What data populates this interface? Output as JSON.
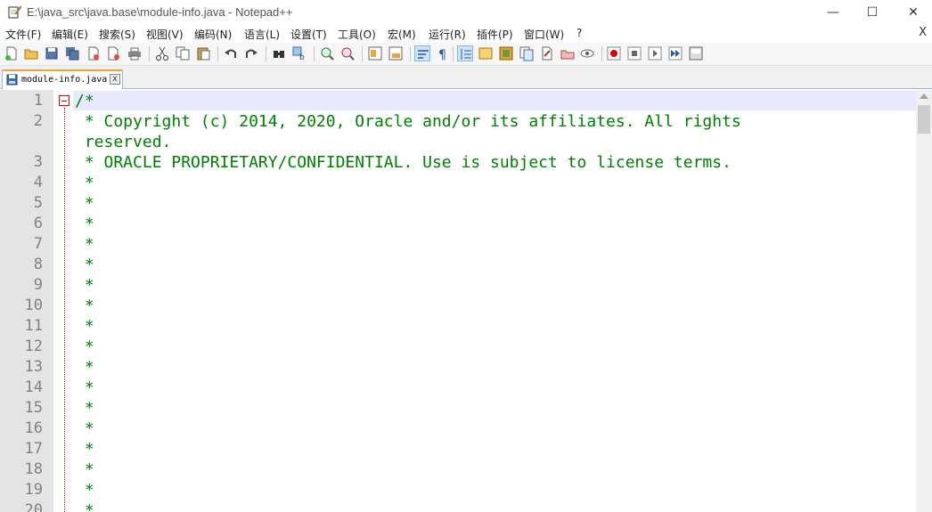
{
  "window": {
    "title": "E:\\java_src\\java.base\\module-info.java - Notepad++",
    "minimize_glyph": "—",
    "maximize_glyph": "☐",
    "close_glyph": "✕"
  },
  "menu": {
    "items": [
      "文件(F)",
      "编辑(E)",
      "搜索(S)",
      "视图(V)",
      "编码(N)",
      "语言(L)",
      "设置(T)",
      "工具(O)",
      "宏(M)",
      "运行(R)",
      "插件(P)",
      "窗口(W)",
      "?"
    ],
    "close_doc": "X"
  },
  "toolbar": {
    "icons": [
      "new-file-icon",
      "open-file-icon",
      "save-icon",
      "save-all-icon",
      "close-icon",
      "close-all-icon",
      "print-icon",
      "cut-icon",
      "copy-icon",
      "paste-icon",
      "undo-icon",
      "redo-icon",
      "find-icon",
      "replace-icon",
      "zoom-in-icon",
      "zoom-out-icon",
      "sync-vertical-icon",
      "sync-horizontal-icon",
      "word-wrap-icon",
      "show-all-chars-icon",
      "indent-guide-icon",
      "document-map-icon",
      "function-list-icon",
      "folder-as-workspace-icon",
      "monitoring-icon",
      "launch-icon",
      "record-macro-icon",
      "stop-record-icon",
      "play-macro-icon",
      "run-macro-multiple-icon",
      "save-macro-icon"
    ]
  },
  "tab": {
    "label": "module-info.java",
    "close_glyph": "x"
  },
  "editor": {
    "lines": [
      {
        "num": "1",
        "text": "/*"
      },
      {
        "num": "2",
        "text": " * Copyright (c) 2014, 2020, Oracle and/or its affiliates. All rights"
      },
      {
        "num": "",
        "text": " reserved."
      },
      {
        "num": "3",
        "text": " * ORACLE PROPRIETARY/CONFIDENTIAL. Use is subject to license terms."
      },
      {
        "num": "4",
        "text": " *"
      },
      {
        "num": "5",
        "text": " *"
      },
      {
        "num": "6",
        "text": " *"
      },
      {
        "num": "7",
        "text": " *"
      },
      {
        "num": "8",
        "text": " *"
      },
      {
        "num": "9",
        "text": " *"
      },
      {
        "num": "10",
        "text": " *"
      },
      {
        "num": "11",
        "text": " *"
      },
      {
        "num": "12",
        "text": " *"
      },
      {
        "num": "13",
        "text": " *"
      },
      {
        "num": "14",
        "text": " *"
      },
      {
        "num": "15",
        "text": " *"
      },
      {
        "num": "16",
        "text": " *"
      },
      {
        "num": "17",
        "text": " *"
      },
      {
        "num": "18",
        "text": " *"
      },
      {
        "num": "19",
        "text": " *"
      },
      {
        "num": "20",
        "text": " *"
      }
    ],
    "comment_color": "#008000",
    "line_number_color": "#808080"
  }
}
